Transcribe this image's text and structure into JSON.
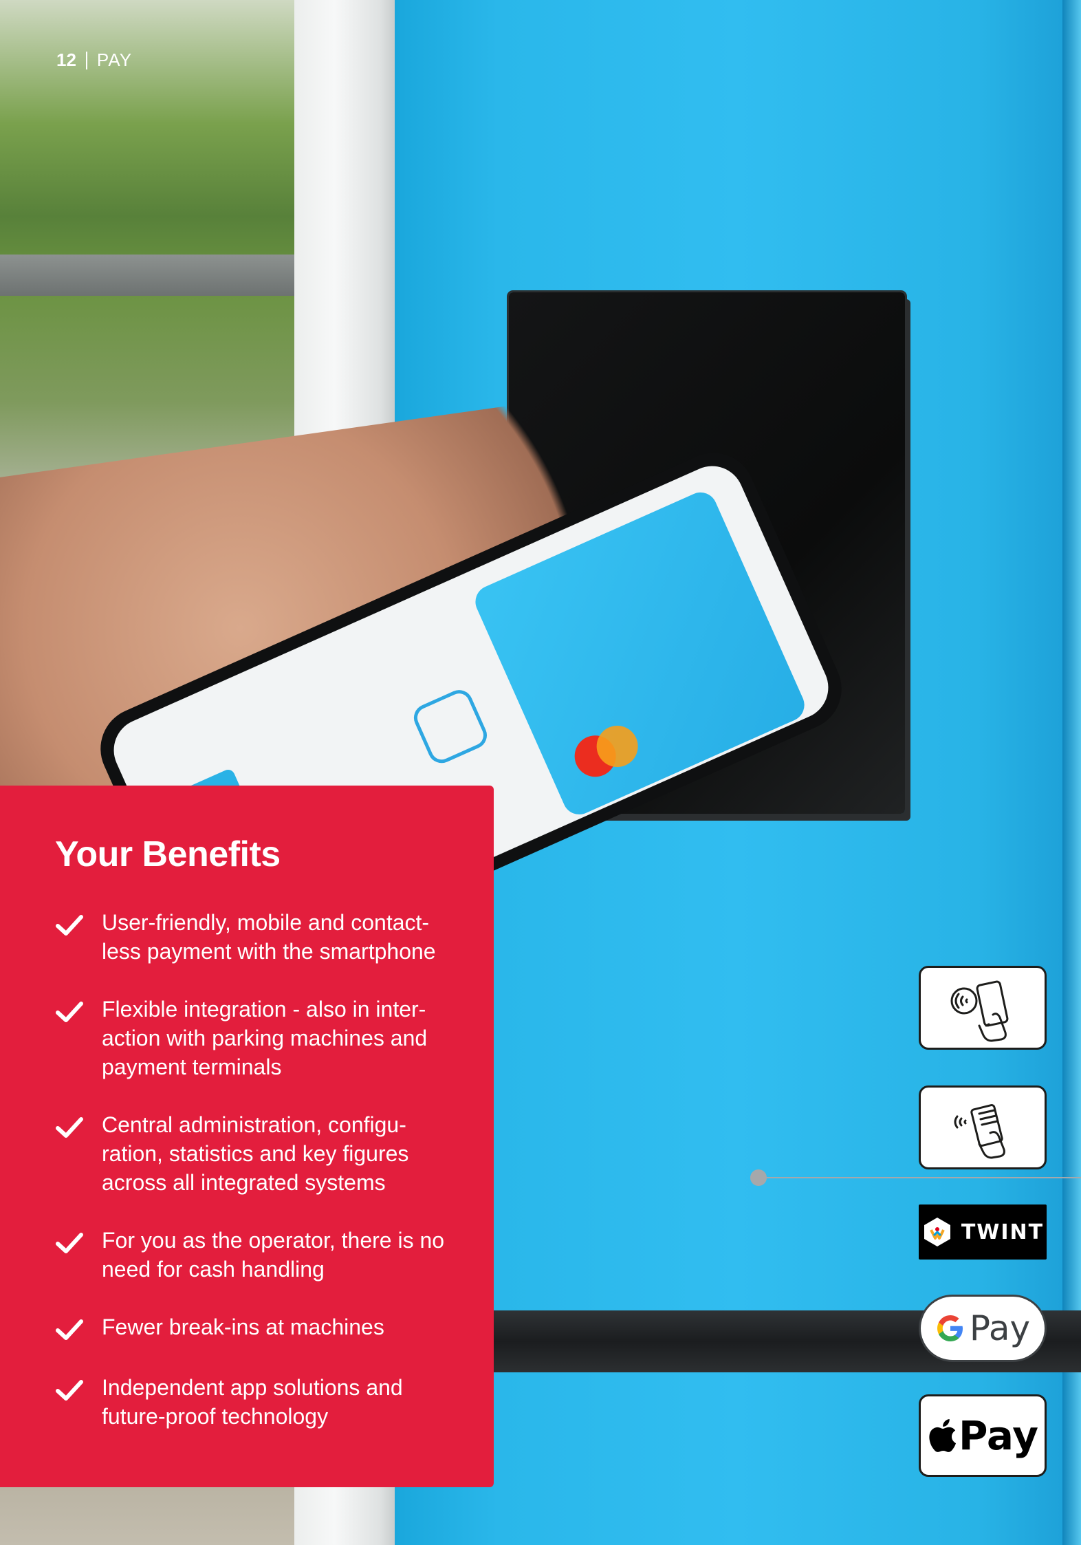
{
  "header": {
    "page_number": "12",
    "section": "PAY"
  },
  "benefits": {
    "title": "Your Benefits",
    "items": [
      {
        "text": "User-friendly, mobile and contact-\nless payment with the smartphone"
      },
      {
        "text": "Flexible integration - also in inter-\naction with parking machines and\npayment terminals"
      },
      {
        "text": "Central administration, configu-\nration, statistics and key figures\nacross all integrated systems"
      },
      {
        "text": "For you as the operator, there is no\nneed for cash handling"
      },
      {
        "text": "Fewer break-ins at machines"
      },
      {
        "text": "Independent app solutions and\nfuture-proof technology"
      }
    ]
  },
  "payment_methods": {
    "twint": "TWINT",
    "gpay": "Pay",
    "apple_pay": "Pay",
    "icons": [
      "mobile-nfc-payment-icon",
      "contactless-card-icon",
      "twint-logo",
      "google-pay-logo",
      "apple-pay-logo"
    ]
  },
  "colors": {
    "benefits_background": "#e31e3d",
    "panel_blue": "#31bdf0",
    "connector_grey": "#a6a8ab"
  }
}
